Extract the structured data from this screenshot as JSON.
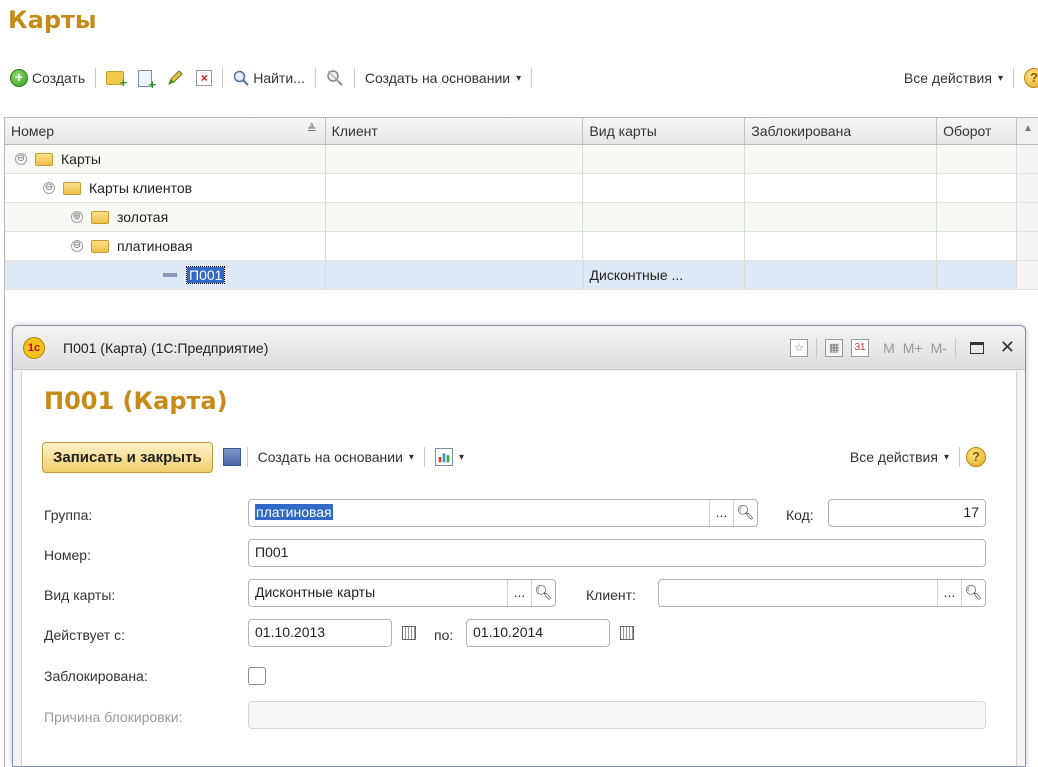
{
  "page": {
    "title": "Карты"
  },
  "toolbar": {
    "create_label": "Создать",
    "find_label": "Найти...",
    "create_based_label": "Создать на основании",
    "all_actions_label": "Все действия",
    "help_label": "?"
  },
  "grid": {
    "columns": [
      "Номер",
      "Клиент",
      "Вид карты",
      "Заблокирована",
      "Оборот"
    ],
    "rows": [
      {
        "toggle": "⊖",
        "label": "Карты",
        "client": "",
        "type": "",
        "blocked": ""
      },
      {
        "toggle": "⊖",
        "label": "Карты клиентов",
        "client": "",
        "type": "",
        "blocked": ""
      },
      {
        "toggle": "⊕",
        "label": "золотая",
        "client": "",
        "type": "",
        "blocked": ""
      },
      {
        "toggle": "⊖",
        "label": "платиновая",
        "client": "",
        "type": "",
        "blocked": ""
      },
      {
        "toggle": "",
        "label": "П001",
        "client": "",
        "type": "Дисконтные ...",
        "blocked": ""
      }
    ]
  },
  "window": {
    "title": "П001 (Карта)  (1С:Предприятие)",
    "tools": [
      "M",
      "M+",
      "M-"
    ],
    "logo": "1с",
    "form_title": "П001 (Карта)",
    "save_close_label": "Записать и закрыть",
    "create_based_label": "Создать на основании",
    "all_actions_label": "Все действия",
    "help_label": "?",
    "fields": {
      "group_label": "Группа:",
      "group_value": "платиновая",
      "code_label": "Код:",
      "code_value": "17",
      "number_label": "Номер:",
      "number_value": "П001",
      "card_type_label": "Вид карты:",
      "card_type_value": "Дисконтные карты",
      "client_label": "Клиент:",
      "client_value": "",
      "valid_from_label": "Действует с:",
      "valid_from_value": "01.10.2013",
      "valid_to_label": "по:",
      "valid_to_value": "01.10.2014",
      "blocked_label": "Заблокирована:",
      "blocked_checked": false,
      "block_reason_label": "Причина блокировки:",
      "block_reason_value": ""
    }
  }
}
